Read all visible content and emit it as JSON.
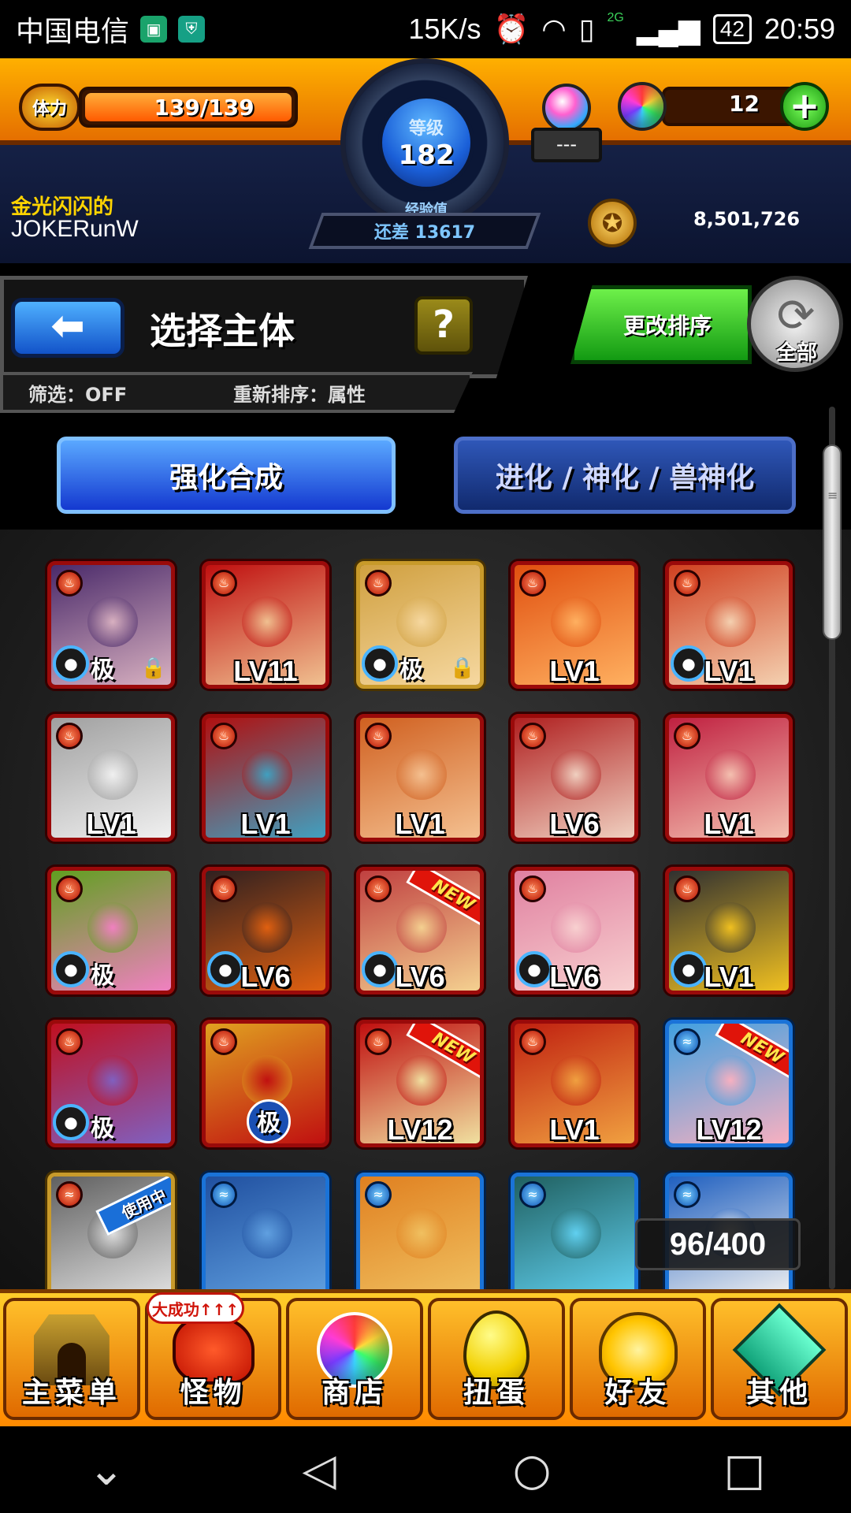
{
  "status_bar": {
    "carrier": "中国电信",
    "net_speed": "15K/s",
    "network_type": "2G",
    "battery": "42",
    "time": "20:59"
  },
  "header": {
    "stamina_label": "体力",
    "stamina_text": "139/139",
    "stamina_fraction": 1.0,
    "level_label": "等级",
    "level": "182",
    "exp_label": "经验值",
    "exp_remaining": "还差 13617",
    "orb_box_text": "---",
    "orb_count": "12",
    "plus_label": "+",
    "player_title": "金光闪闪的",
    "player_name": "JOKERunW",
    "coins": "8,501,726"
  },
  "titlebar": {
    "back_label": "⬅",
    "title": "选择主体",
    "help_label": "?",
    "filter": "筛选：OFF",
    "sort": "重新排序：属性",
    "change_sort": "更改排序",
    "all_label": "全部"
  },
  "modes": {
    "fusion": "强化合成",
    "evolution": "进化 / 神化 / 兽神化"
  },
  "monsters": [
    {
      "level": "",
      "tag": "极",
      "locked": true,
      "element": "fire",
      "frame": "fire",
      "badge": ""
    },
    {
      "level": "LV11",
      "tag": "",
      "locked": false,
      "element": "fire",
      "frame": "fire",
      "badge": ""
    },
    {
      "level": "",
      "tag": "极",
      "locked": true,
      "element": "fire",
      "frame": "gold",
      "badge": ""
    },
    {
      "level": "LV1",
      "tag": "",
      "locked": false,
      "element": "fire",
      "frame": "fire",
      "badge": ""
    },
    {
      "level": "LV1",
      "tag": "",
      "locked": false,
      "element": "fire",
      "frame": "fire",
      "badge": ""
    },
    {
      "level": "LV1",
      "tag": "",
      "locked": false,
      "element": "fire",
      "frame": "fire",
      "badge": ""
    },
    {
      "level": "LV1",
      "tag": "",
      "locked": false,
      "element": "fire",
      "frame": "fire",
      "badge": ""
    },
    {
      "level": "LV1",
      "tag": "",
      "locked": false,
      "element": "fire",
      "frame": "fire",
      "badge": ""
    },
    {
      "level": "LV6",
      "tag": "",
      "locked": false,
      "element": "fire",
      "frame": "fire",
      "badge": ""
    },
    {
      "level": "LV1",
      "tag": "",
      "locked": false,
      "element": "fire",
      "frame": "fire",
      "badge": ""
    },
    {
      "level": "",
      "tag": "极",
      "locked": false,
      "element": "fire",
      "frame": "fire",
      "badge": ""
    },
    {
      "level": "LV6",
      "tag": "",
      "locked": false,
      "element": "fire",
      "frame": "fire",
      "badge": ""
    },
    {
      "level": "LV6",
      "tag": "",
      "locked": false,
      "element": "fire",
      "frame": "fire",
      "badge": "NEW"
    },
    {
      "level": "LV6",
      "tag": "",
      "locked": false,
      "element": "fire",
      "frame": "fire",
      "badge": ""
    },
    {
      "level": "LV1",
      "tag": "",
      "locked": false,
      "element": "fire",
      "frame": "fire",
      "badge": ""
    },
    {
      "level": "",
      "tag": "极",
      "locked": false,
      "element": "fire",
      "frame": "fire",
      "badge": ""
    },
    {
      "level": "",
      "tag": "极",
      "locked": false,
      "element": "fire",
      "frame": "fire",
      "badge": ""
    },
    {
      "level": "LV12",
      "tag": "",
      "locked": false,
      "element": "fire",
      "frame": "fire",
      "badge": "NEW"
    },
    {
      "level": "LV1",
      "tag": "",
      "locked": false,
      "element": "fire",
      "frame": "fire",
      "badge": ""
    },
    {
      "level": "LV12",
      "tag": "",
      "locked": false,
      "element": "water",
      "frame": "water",
      "badge": "NEW"
    },
    {
      "level": "",
      "tag": "",
      "locked": false,
      "element": "water",
      "frame": "gold",
      "badge": "使用中"
    },
    {
      "level": "",
      "tag": "",
      "locked": false,
      "element": "water",
      "frame": "water",
      "badge": ""
    },
    {
      "level": "",
      "tag": "",
      "locked": false,
      "element": "water",
      "frame": "water",
      "badge": ""
    },
    {
      "level": "",
      "tag": "",
      "locked": false,
      "element": "water",
      "frame": "water",
      "badge": ""
    },
    {
      "level": "",
      "tag": "",
      "locked": false,
      "element": "water",
      "frame": "water",
      "badge": ""
    }
  ],
  "box_count": "96/400",
  "bottom_nav": {
    "main_menu": "主菜单",
    "monsters": "怪物",
    "monsters_tag": "大成功↑↑↑",
    "shop": "商店",
    "gacha": "扭蛋",
    "friends": "好友",
    "other": "其他"
  },
  "colors": {
    "fire_frame": "#9a0a0a",
    "water_frame": "#1a73d8",
    "gold_frame": "#c89a2a",
    "active_mode": "#1439d0",
    "change_sort_green": "#129a12"
  }
}
